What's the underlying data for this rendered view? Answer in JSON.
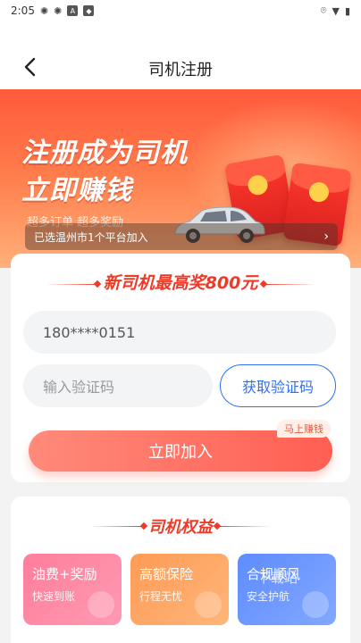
{
  "status_bar": {
    "time": "2:05",
    "icons": [
      "burst-icon",
      "burst-icon",
      "a-box-icon",
      "shield-icon"
    ],
    "right_icons": [
      "location-icon",
      "wifi-icon",
      "battery-icon"
    ]
  },
  "nav": {
    "title": "司机注册",
    "back_icon": "chevron-left-icon"
  },
  "banner": {
    "title_line1": "注册成为司机",
    "title_line2": "立即赚钱",
    "tags": "超多订单    超多奖励",
    "info_text": "已选温州市1个平台加入",
    "info_arrow": "›"
  },
  "form": {
    "promo_text": "新司机最高奖800元",
    "phone_value": "180****0151",
    "code_placeholder": "输入验证码",
    "get_code_label": "获取验证码",
    "join_label": "立即加入",
    "join_badge": "马上赚钱"
  },
  "benefits": {
    "title": "司机权益",
    "items": [
      {
        "title": "油费+奖励",
        "subtitle": "快速到账",
        "color": "#ff7d9c"
      },
      {
        "title": "高额保险",
        "subtitle": "行程无忧",
        "color": "#ff9a55"
      },
      {
        "title": "合规顺风",
        "overlay": "下载站",
        "subtitle": "安全护航",
        "color": "#5e8cff"
      }
    ]
  }
}
